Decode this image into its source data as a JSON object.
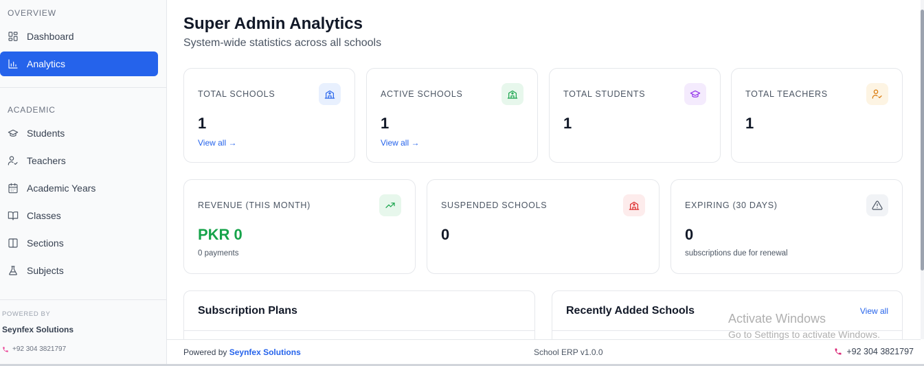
{
  "sidebar": {
    "overview_title": "OVERVIEW",
    "academic_title": "ACADEMIC",
    "items": [
      {
        "label": "Dashboard",
        "icon": "dashboard-icon"
      },
      {
        "label": "Analytics",
        "icon": "bar-chart-icon",
        "active": true
      },
      {
        "label": "Students",
        "icon": "graduation-cap-icon"
      },
      {
        "label": "Teachers",
        "icon": "user-check-icon"
      },
      {
        "label": "Academic Years",
        "icon": "calendar-icon"
      },
      {
        "label": "Classes",
        "icon": "book-open-icon"
      },
      {
        "label": "Sections",
        "icon": "columns-icon"
      },
      {
        "label": "Subjects",
        "icon": "flask-icon"
      }
    ],
    "footer": {
      "powered_label": "POWERED BY",
      "company": "Seynfex Solutions",
      "phone": "+92 304 3821797"
    }
  },
  "header": {
    "title": "Super Admin Analytics",
    "subtitle": "System-wide statistics across all schools"
  },
  "stats": [
    {
      "label": "TOTAL SCHOOLS",
      "value": "1",
      "link": "View all →",
      "icon": "school-icon",
      "color": "#2563eb",
      "bg": "#e8f0fe"
    },
    {
      "label": "ACTIVE SCHOOLS",
      "value": "1",
      "link": "View all →",
      "icon": "school-icon",
      "color": "#16a34a",
      "bg": "#e7f7ec"
    },
    {
      "label": "TOTAL STUDENTS",
      "value": "1",
      "icon": "graduation-cap-icon",
      "color": "#9333ea",
      "bg": "#f4ebfd"
    },
    {
      "label": "TOTAL TEACHERS",
      "value": "1",
      "icon": "user-check-icon",
      "color": "#d97706",
      "bg": "#fdf4e3"
    }
  ],
  "stats2": [
    {
      "label": "REVENUE (THIS MONTH)",
      "value": "PKR 0",
      "sub": "0 payments",
      "icon": "trending-up-icon",
      "color": "#16a34a",
      "bg": "#e7f7ec"
    },
    {
      "label": "SUSPENDED SCHOOLS",
      "value": "0",
      "icon": "school-icon",
      "color": "#dc2626",
      "bg": "#fdecec"
    },
    {
      "label": "EXPIRING (30 DAYS)",
      "value": "0",
      "sub": "subscriptions due for renewal",
      "icon": "alert-triangle-icon",
      "color": "#4b5563",
      "bg": "#f1f3f6"
    }
  ],
  "panels": {
    "plans_title": "Subscription Plans",
    "recent_title": "Recently Added Schools",
    "recent_link": "View all"
  },
  "footer": {
    "powered_by": "Powered by",
    "company": "Seynfex Solutions",
    "version": "School ERP v1.0.0",
    "phone": "+92 304 3821797"
  },
  "watermark": {
    "line1": "Activate Windows",
    "line2": "Go to Settings to activate Windows."
  }
}
